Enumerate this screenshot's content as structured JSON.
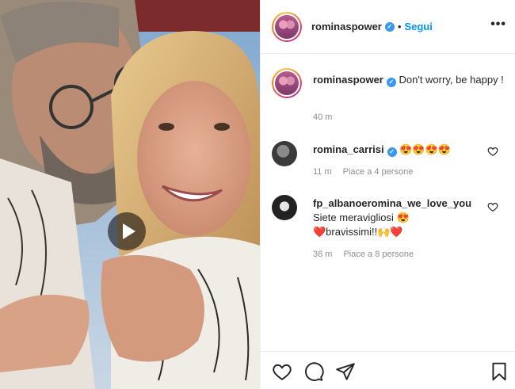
{
  "post": {
    "username": "rominaspower",
    "follow_label": "Segui",
    "separator": "•",
    "more_label": "•••",
    "caption": "Don't worry, be happy !",
    "caption_time": "40 m",
    "verified_mark": "✓"
  },
  "comments": [
    {
      "username": "romina_carrisi",
      "text": "😍😍😍😍",
      "time": "11 m",
      "likes": "Piace a 4 persone"
    },
    {
      "username": "fp_albanoeromina_we_love_you",
      "line1": "Siete meravigliosi 😍",
      "line2": "❤️bravissimi!!🙌❤️",
      "time": "36 m",
      "likes": "Piace a 8 persone"
    }
  ],
  "colors": {
    "link_blue": "#0095f6",
    "verified_blue": "#3897f0",
    "meta_gray": "#8e8e8e"
  },
  "icons": [
    "play-icon",
    "heart-icon",
    "comment-icon",
    "share-icon",
    "bookmark-icon",
    "more-icon",
    "verified-icon"
  ]
}
